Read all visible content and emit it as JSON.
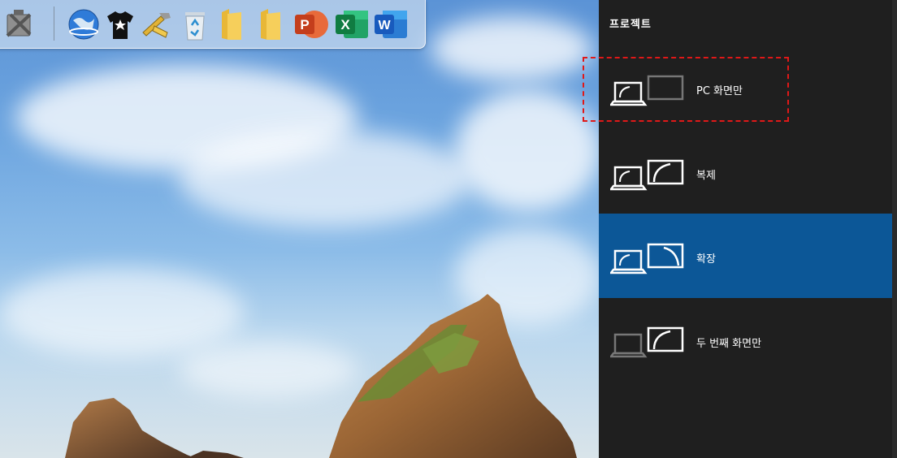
{
  "panel": {
    "title": "프로젝트",
    "options": [
      {
        "label": "PC 화면만",
        "selected": false
      },
      {
        "label": "복제",
        "selected": false
      },
      {
        "label": "확장",
        "selected": true
      },
      {
        "label": "두 번째 화면만",
        "selected": false
      }
    ]
  },
  "dock": {
    "icons": [
      "system-tools-icon",
      "globe-icon",
      "tshirt-icon",
      "utilities-icon",
      "recycle-bin-icon",
      "folder-icon",
      "folder-icon",
      "powerpoint-icon",
      "excel-icon",
      "word-icon"
    ],
    "office_letters": {
      "powerpoint": "P",
      "excel": "X",
      "word": "W"
    }
  },
  "colors": {
    "panel_bg": "#1f1f1f",
    "selected_bg": "#0c5797",
    "focus_outline": "#e01818"
  }
}
